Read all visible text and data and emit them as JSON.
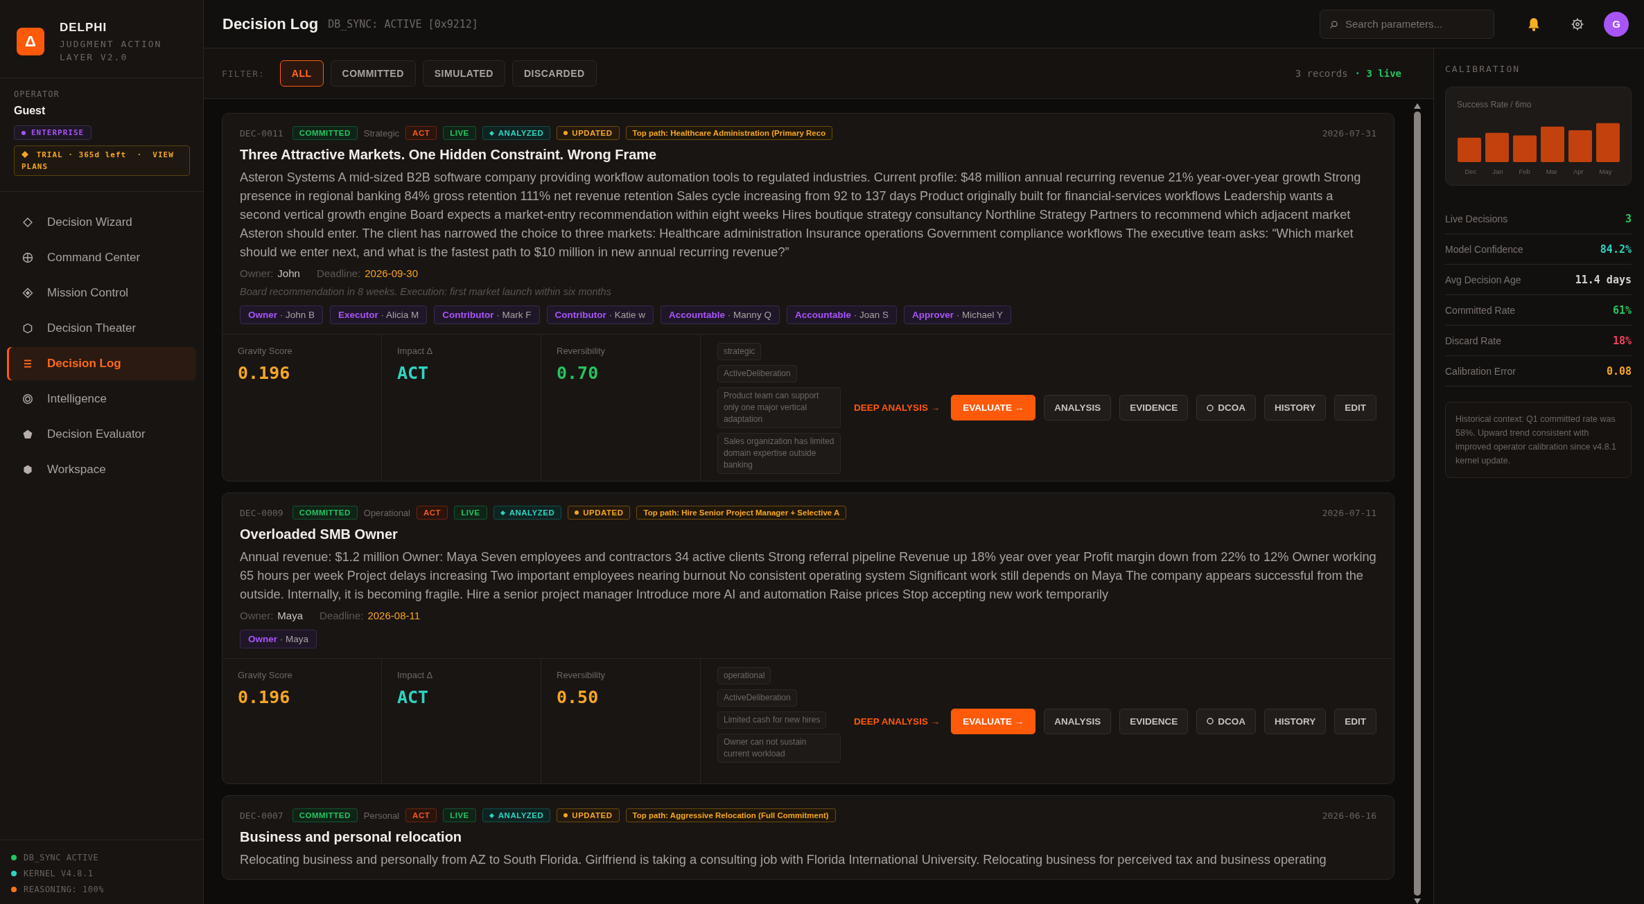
{
  "sidebar": {
    "logo_mark": "Δ",
    "brand": "DELPHI",
    "tagline": "JUDGMENT ACTION LAYER V2.0",
    "operator_label": "OPERATOR",
    "operator": "Guest",
    "plan": "ENTERPRISE",
    "trial": "TRIAL · 365d left  ·  VIEW PLANS",
    "nav": [
      {
        "label": "Decision Wizard",
        "selected": false
      },
      {
        "label": "Command Center",
        "selected": false
      },
      {
        "label": "Mission Control",
        "selected": false
      },
      {
        "label": "Decision Theater",
        "selected": false
      },
      {
        "label": "Decision Log",
        "selected": true
      },
      {
        "label": "Intelligence",
        "selected": false
      },
      {
        "label": "Decision Evaluator",
        "selected": false
      },
      {
        "label": "Workspace",
        "selected": false
      }
    ],
    "status": [
      {
        "label": "DB_SYNC ACTIVE",
        "color": "#22c55e"
      },
      {
        "label": "KERNEL V4.8.1",
        "color": "#2dd4bf"
      },
      {
        "label": "REASONING: 100%",
        "color": "#f97316"
      }
    ]
  },
  "header": {
    "title": "Decision Log",
    "subtitle": "DB_SYNC: ACTIVE [0x9212]",
    "search": {
      "placeholder": "Search parameters..."
    },
    "avatar": "G"
  },
  "filter": {
    "label": "FILTER:",
    "tabs": [
      {
        "label": "ALL",
        "selected": true
      },
      {
        "label": "COMMITTED",
        "selected": false
      },
      {
        "label": "SIMULATED",
        "selected": false
      },
      {
        "label": "DISCARDED",
        "selected": false
      }
    ],
    "records": "3 records",
    "live": "· 3 live"
  },
  "decisions": [
    {
      "id": "DEC-0011",
      "date": "2026-07-31",
      "badges": [
        {
          "kind": "status",
          "text": "COMMITTED"
        },
        {
          "kind": "category",
          "text": "Strategic"
        },
        {
          "kind": "act",
          "text": "ACT"
        },
        {
          "kind": "live",
          "text": "LIVE"
        },
        {
          "kind": "analyzed",
          "text": "ANALYZED"
        },
        {
          "kind": "updated",
          "text": "UPDATED"
        },
        {
          "kind": "path",
          "text": "Top path: Healthcare Administration (Primary Reco"
        }
      ],
      "title": "Three Attractive Markets. One Hidden Constraint. Wrong Frame",
      "description": "Asteron Systems A mid-sized B2B software company providing workflow automation tools to regulated industries. Current profile: $48 million annual recurring revenue 21% year-over-year growth Strong presence in regional banking 84% gross retention 111% net revenue retention Sales cycle increasing from 92 to 137 days Product originally built for financial-services workflows Leadership wants a second vertical growth engine Board expects a market-entry recommendation within eight weeks Hires boutique strategy consultancy Northline Strategy Partners to recommend which adjacent market Asteron should enter. The client has narrowed the choice to three markets: Healthcare administration Insurance operations Government compliance workflows The executive team asks: “Which market should we enter next, and what is the fastest path to $10 million in new annual recurring revenue?”",
      "owner_label": "Owner:",
      "owner": "John",
      "deadline_label": "Deadline:",
      "deadline": "2026-09-30",
      "note": "Board recommendation in 8 weeks. Execution: first market launch within six months",
      "roles": [
        {
          "role": "Owner",
          "name": "· John B"
        },
        {
          "role": "Executor",
          "name": "· Alicia M"
        },
        {
          "role": "Contributor",
          "name": "· Mark F"
        },
        {
          "role": "Contributor",
          "name": "· Katie w"
        },
        {
          "role": "Accountable",
          "name": "· Manny Q"
        },
        {
          "role": "Accountable",
          "name": "· Joan S"
        },
        {
          "role": "Approver",
          "name": "· Michael Y"
        }
      ],
      "metrics": [
        {
          "label": "Gravity Score",
          "value": "0.196",
          "color": "#f5a623"
        },
        {
          "label": "Impact Δ",
          "value": "ACT",
          "color": "#2dd4bf"
        },
        {
          "label": "Reversibility",
          "value": "0.70",
          "color": "#22c55e"
        }
      ],
      "tags": [
        "strategic",
        "ActiveDeliberation",
        "Product team can support only one major vertical adaptation",
        "Sales organization has limited domain expertise outside banking"
      ],
      "actions": [
        {
          "kind": "link",
          "label": "DEEP ANALYSIS →"
        },
        {
          "kind": "primary",
          "label": "EVALUATE →"
        },
        {
          "kind": "button",
          "label": "ANALYSIS"
        },
        {
          "kind": "button",
          "label": "EVIDENCE"
        },
        {
          "kind": "dcoa",
          "label": "DCOA"
        },
        {
          "kind": "button",
          "label": "HISTORY"
        },
        {
          "kind": "button",
          "label": "EDIT"
        }
      ]
    },
    {
      "id": "DEC-0009",
      "date": "2026-07-11",
      "badges": [
        {
          "kind": "status",
          "text": "COMMITTED"
        },
        {
          "kind": "category",
          "text": "Operational"
        },
        {
          "kind": "act",
          "text": "ACT"
        },
        {
          "kind": "live",
          "text": "LIVE"
        },
        {
          "kind": "analyzed",
          "text": "ANALYZED"
        },
        {
          "kind": "updated",
          "text": "UPDATED"
        },
        {
          "kind": "path",
          "text": "Top path: Hire Senior Project Manager + Selective A"
        }
      ],
      "title": "Overloaded SMB Owner",
      "description": "Annual revenue: $1.2 million Owner: Maya Seven employees and contractors 34 active clients Strong referral pipeline Revenue up 18% year over year Profit margin down from 22% to 12% Owner working 65 hours per week Project delays increasing Two important employees nearing burnout No consistent operating system Significant work still depends on Maya The company appears successful from the outside. Internally, it is becoming fragile. Hire a senior project manager Introduce more AI and automation Raise prices Stop accepting new work temporarily",
      "owner_label": "Owner:",
      "owner": "Maya",
      "deadline_label": "Deadline:",
      "deadline": "2026-08-11",
      "roles": [
        {
          "role": "Owner",
          "name": "· Maya"
        }
      ],
      "metrics": [
        {
          "label": "Gravity Score",
          "value": "0.196",
          "color": "#f5a623"
        },
        {
          "label": "Impact Δ",
          "value": "ACT",
          "color": "#2dd4bf"
        },
        {
          "label": "Reversibility",
          "value": "0.50",
          "color": "#f5a623"
        }
      ],
      "tags": [
        "operational",
        "ActiveDeliberation",
        "Limited cash for new hires",
        "Owner can not sustain current workload"
      ],
      "actions": [
        {
          "kind": "link",
          "label": "DEEP ANALYSIS →"
        },
        {
          "kind": "primary",
          "label": "EVALUATE →"
        },
        {
          "kind": "button",
          "label": "ANALYSIS"
        },
        {
          "kind": "button",
          "label": "EVIDENCE"
        },
        {
          "kind": "dcoa",
          "label": "DCOA"
        },
        {
          "kind": "button",
          "label": "HISTORY"
        },
        {
          "kind": "button",
          "label": "EDIT"
        }
      ]
    },
    {
      "id": "DEC-0007",
      "date": "2026-06-16",
      "badges": [
        {
          "kind": "status",
          "text": "COMMITTED"
        },
        {
          "kind": "category",
          "text": "Personal"
        },
        {
          "kind": "act",
          "text": "ACT"
        },
        {
          "kind": "live",
          "text": "LIVE"
        },
        {
          "kind": "analyzed",
          "text": "ANALYZED"
        },
        {
          "kind": "updated",
          "text": "UPDATED"
        },
        {
          "kind": "path",
          "text": "Top path: Aggressive Relocation (Full Commitment)"
        }
      ],
      "title": "Business and personal relocation",
      "description": "Relocating business and personally from AZ to South Florida. Girlfriend is taking a consulting job with Florida International University. Relocating business for perceived tax and business operating"
    }
  ],
  "calibration": {
    "title": "CALIBRATION",
    "chart_title": "Success Rate / 6mo",
    "months": [
      "Dec",
      "Jan",
      "Feb",
      "Mar",
      "Apr",
      "May"
    ],
    "stats": [
      {
        "label": "Live Decisions",
        "value": "3",
        "color": "#22c55e"
      },
      {
        "label": "Model Confidence",
        "value": "84.2%",
        "color": "#2dd4bf"
      },
      {
        "label": "Avg Decision Age",
        "value": "11.4 days",
        "color": "#d4d4d4"
      },
      {
        "label": "Committed Rate",
        "value": "61%",
        "color": "#22c55e"
      },
      {
        "label": "Discard Rate",
        "value": "18%",
        "color": "#f43f5e"
      },
      {
        "label": "Calibration Error",
        "value": "0.08",
        "color": "#f5a623"
      }
    ],
    "context": "Historical context: Q1 committed rate was 58%. Upward trend consistent with improved operator calibration since v4.8.1 kernel update."
  }
}
